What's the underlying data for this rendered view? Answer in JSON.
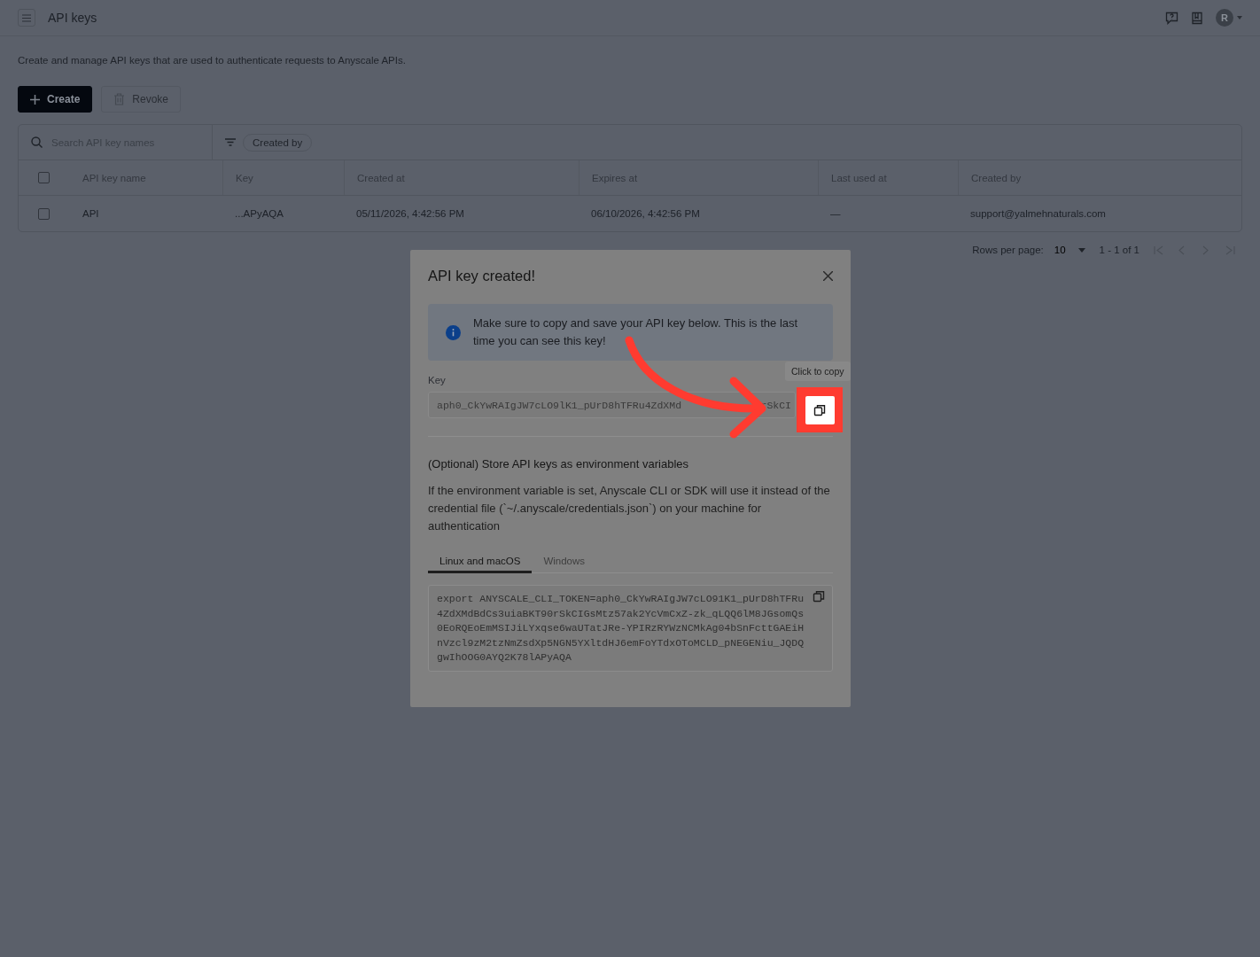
{
  "header": {
    "title": "API keys"
  },
  "description": "Create and manage API keys that are used to authenticate requests to Anyscale APIs.",
  "user": {
    "initial": "R"
  },
  "actions": [
    {
      "kind": "primary",
      "label": "Create"
    },
    {
      "kind": "secondary",
      "label": "Revoke"
    }
  ],
  "search": {
    "placeholder": "Search API key names"
  },
  "filter": {
    "label": "Created by"
  },
  "table": {
    "columns": [
      "API key name",
      "Key",
      "Created at",
      "Expires at",
      "Last used at",
      "Created by"
    ],
    "all_checked": false,
    "rows": [
      {
        "checked": false,
        "cells": [
          "API",
          "...APyAQA",
          "05/11/2026, 4:42:56 PM",
          "06/10/2026, 4:42:56 PM",
          "—",
          "support@yalmehnaturals.com"
        ]
      }
    ]
  },
  "pagination": {
    "label": "Rows per page:",
    "rows_per_page": "10",
    "range": "1 - 1 of 1"
  },
  "dialog": {
    "title": "API key created!",
    "notice": "Make sure to copy and save your API key below. This is the last time you can see this key!",
    "key_label": "Key",
    "key_value": [
      "aph0_CkYwRAIgJW7cLO9lK1_pUrD8hTFRu4ZdXMd",
      "rSkCI"
    ],
    "tooltip": "Click to copy",
    "env_title": "(Optional) Store API keys as environment variables",
    "env_text": "If the environment variable is set, Anyscale CLI or SDK will use it instead of the credential file (`~/.anyscale/credentials.json`) on your machine for authentication",
    "tabs": [
      {
        "label": "Linux and macOS",
        "selected": true
      },
      {
        "label": "Windows",
        "selected": false
      }
    ],
    "code": "export ANYSCALE_CLI_TOKEN=aph0_CkYwRAIgJW7cLO91K1_pUrD8hTFRu4ZdXMdBdCs3uiaBKT90rSkCIGsMtz57ak2YcVmCxZ-zk_qLQQ6lM8JGsomQs0EoRQEoEmMSIJiLYxqse6waUTatJRe-YPIRzRYWzNCMkAg04bSnFcttGAEiHnVzcl9zM2tzNmZsdXp5NGN5YXltdHJ6emFoYTdxOToMCLD_pNEGENiu_JQDQgwIhOOG0AYQ2K78lAPyAQA"
  }
}
